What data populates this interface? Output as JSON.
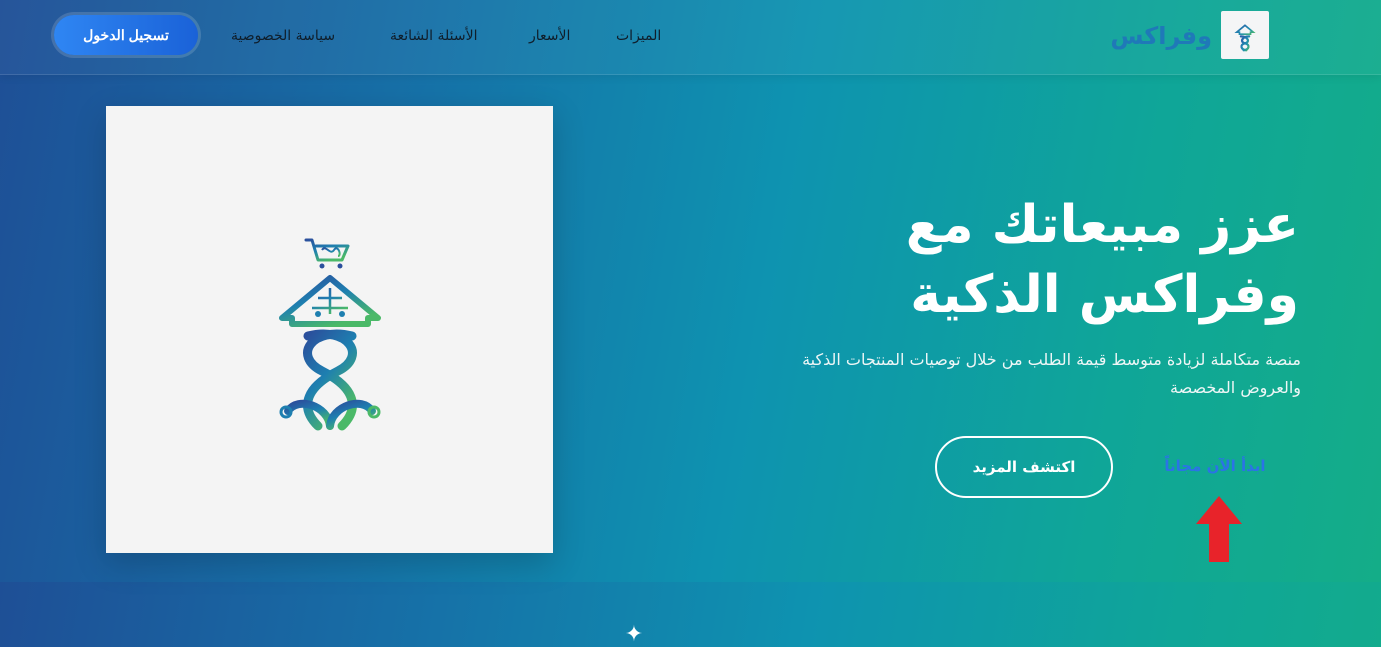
{
  "header": {
    "brand_name": "وفراكس",
    "nav": [
      {
        "label": "الميزات"
      },
      {
        "label": "الأسعار"
      },
      {
        "label": "الأسئلة الشائعة"
      },
      {
        "label": "سياسة الخصوصية"
      }
    ],
    "login_label": "تسجيل الدخول"
  },
  "hero": {
    "headline_line1": "عزز مبيعاتك مع",
    "headline_line2": "وفراكس الذكية",
    "subtitle_line1": "منصة متكاملة لزيادة متوسط قيمة الطلب من خلال توصيات المنتجات الذكية",
    "subtitle_line2": "والعروض المخصصة",
    "cta_primary_label": "اكتشف المزيد",
    "cta_secondary_label": "ابدأ الآن مجاناً"
  },
  "colors": {
    "accent_blue": "#2b73e6",
    "annotation_arrow": "#e8232a",
    "brand_blue": "#1f79b8"
  },
  "icons": {
    "logo": "wafrax-emblem-icon",
    "sparkle": "sparkle-icon",
    "annotation": "red-arrow-up-icon"
  }
}
